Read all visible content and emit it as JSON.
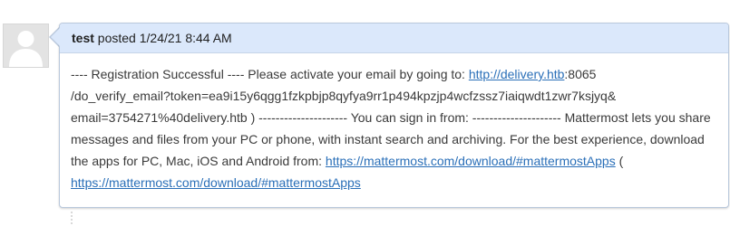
{
  "post": {
    "author": "test",
    "action": "posted",
    "timestamp": "1/24/21 8:44 AM",
    "body": {
      "line1_text": "---- Registration Successful ---- Please activate your email by going to: ",
      "link1_text": "http://delivery.htb",
      "line1_suffix": ":8065",
      "line2_text": "/do_verify_email?token=ea9i15y6qgg1fzkpbjp8qyfya9rr1p494kpzjp4wcfzssz7iaiqwdt1zwr7ksjyq&",
      "line3_text": "email=3754271%40delivery.htb ) --------------------- You can sign in from: --------------------- Mattermost lets you share",
      "line4_text": "messages and files from your PC or phone, with instant search and archiving. For the best experience, download",
      "line5_text": "the apps for PC, Mac, iOS and Android from: ",
      "link2_text": "https://mattermost.com/download/#mattermostApps",
      "line5_suffix": " (",
      "link3_text": "https://mattermost.com/download/#mattermostApps"
    }
  },
  "colors": {
    "header_background": "#dbe8fb",
    "link": "#2a6fb8",
    "border": "#b9c8dc"
  },
  "icons": {
    "avatar": "default-user-avatar-icon"
  }
}
